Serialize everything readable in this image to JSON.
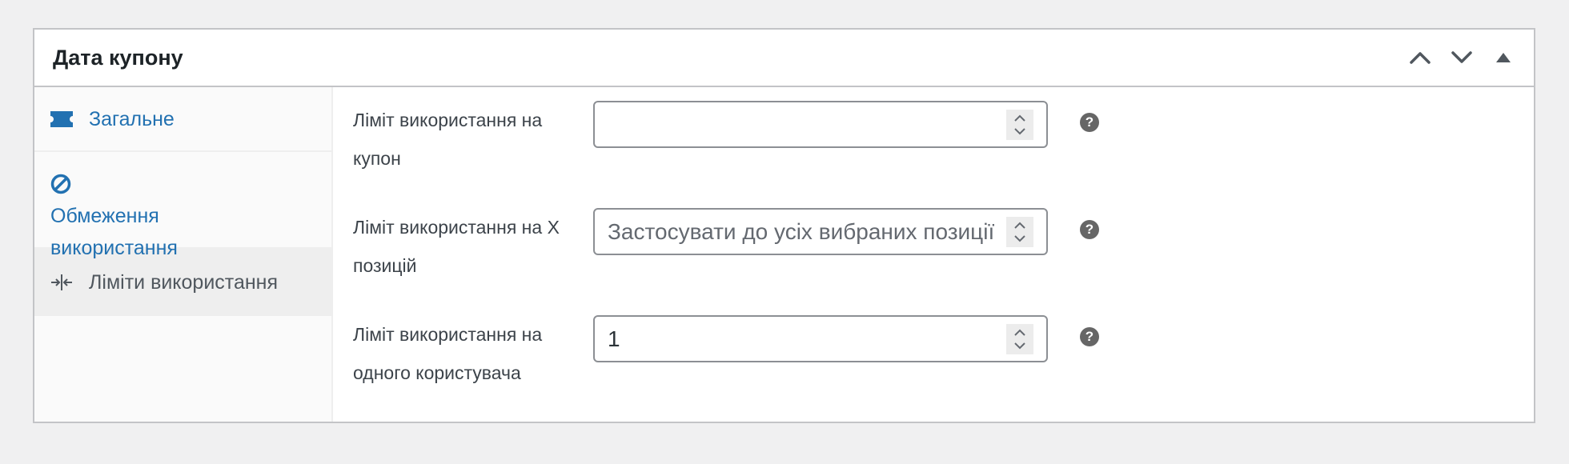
{
  "postbox": {
    "title": "Дата купону"
  },
  "tabs": [
    {
      "label": "Загальне",
      "icon": "ticket-icon"
    },
    {
      "label": "Обмеження використання",
      "icon": "prohibited-icon"
    },
    {
      "label": "Ліміти використання",
      "icon": "limits-icon",
      "active": true
    }
  ],
  "fields": [
    {
      "label": "Ліміт використання на купон",
      "value": "",
      "placeholder": ""
    },
    {
      "label": "Ліміт використання на X позицій",
      "value": "",
      "placeholder": "Застосувати до усіх вибраних позиції"
    },
    {
      "label": "Ліміт використання на одного користувача",
      "value": "1",
      "placeholder": ""
    }
  ],
  "help_icon": "?",
  "colors": {
    "link": "#2271b1",
    "active_tab_bg": "#eeeeee",
    "border": "#c3c4c7",
    "help_bg": "#666666"
  }
}
